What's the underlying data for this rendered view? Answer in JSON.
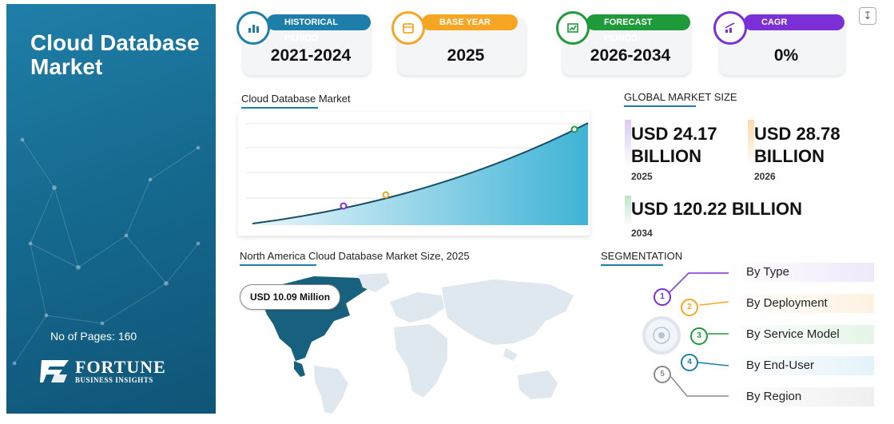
{
  "title": "Cloud Database Market",
  "pages": "No of Pages: 160",
  "logo": {
    "main": "FORTUNE",
    "sub": "BUSINESS INSIGHTS"
  },
  "stats": [
    {
      "label": "HISTORICAL PERIOD",
      "value": "2021-2024",
      "color": "#1d7fa9",
      "icon": "bar-chart-icon"
    },
    {
      "label": "BASE YEAR",
      "value": "2025",
      "color": "#f6a623",
      "icon": "calendar-icon"
    },
    {
      "label": "FORECAST PERIOD",
      "value": "2026-2034",
      "color": "#1f9a3a",
      "icon": "forecast-chart-icon"
    },
    {
      "label": "CAGR",
      "value": "0%",
      "color": "#7b2fd6",
      "icon": "growth-chart-icon"
    }
  ],
  "chart": {
    "label": "Cloud Database Market"
  },
  "market": {
    "label": "GLOBAL MARKET SIZE",
    "items": [
      {
        "value": "USD 24.17 BILLION",
        "year": "2025",
        "color": "#e6ddf6"
      },
      {
        "value": "USD 28.78 BILLION",
        "year": "2026",
        "color": "#fde9cf"
      },
      {
        "value": "USD 120.22 BILLION",
        "year": "2034",
        "color": "#d8f0dc"
      }
    ]
  },
  "map": {
    "label": "North America Cloud Database Market Size, 2025",
    "value": "USD 10.09 Million"
  },
  "segmentation": {
    "label": "SEGMENTATION",
    "items": [
      {
        "num": "1",
        "label": "By Type",
        "color": "#7b2fd6",
        "bg": "#efe8fb"
      },
      {
        "num": "2",
        "label": "By Deployment",
        "color": "#f6a623",
        "bg": "#fdf2e1"
      },
      {
        "num": "3",
        "label": "By Service Model",
        "color": "#1f9a3a",
        "bg": "#e5f5e8"
      },
      {
        "num": "4",
        "label": "By End-User",
        "color": "#1d7fa9",
        "bg": "#e4f3f9"
      },
      {
        "num": "5",
        "label": "By Region",
        "color": "#8a8a8a",
        "bg": "#efefef"
      }
    ]
  }
}
